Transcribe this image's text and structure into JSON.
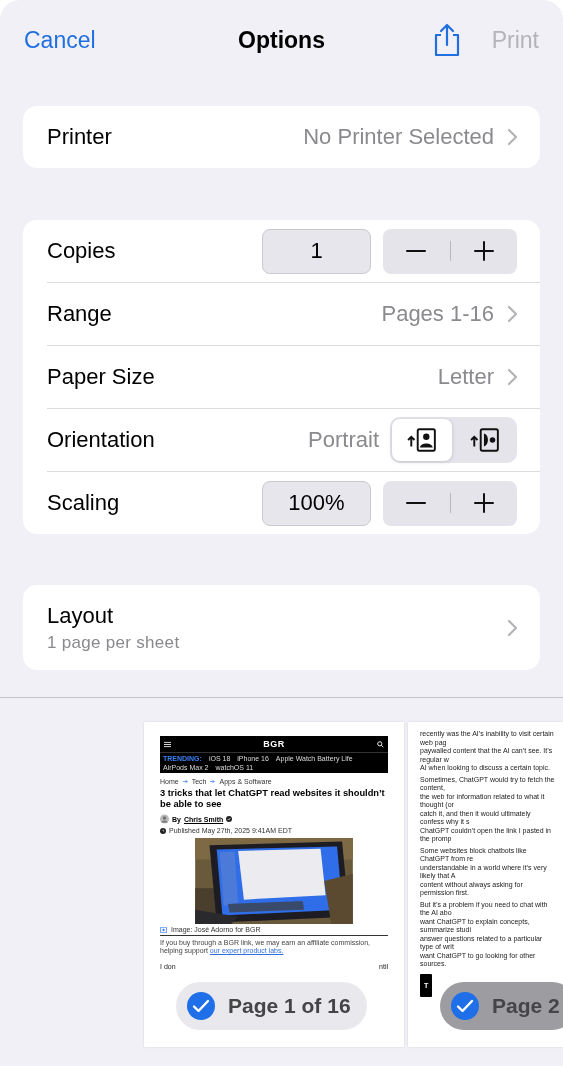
{
  "nav": {
    "cancel": "Cancel",
    "title": "Options",
    "print": {
      "label": "Print",
      "disabled": true
    }
  },
  "printer": {
    "label": "Printer",
    "value": "No Printer Selected"
  },
  "options": [
    {
      "kind": "stepper",
      "label": "Copies",
      "value": "1"
    },
    {
      "kind": "link",
      "label": "Range",
      "value": "Pages 1-16"
    },
    {
      "kind": "link",
      "label": "Paper Size",
      "value": "Letter"
    },
    {
      "kind": "orientation",
      "label": "Orientation",
      "value": "Portrait",
      "choices": [
        {
          "kind": "portrait",
          "selected": true
        },
        {
          "kind": "landscape",
          "selected": false
        }
      ]
    },
    {
      "kind": "stepper",
      "label": "Scaling",
      "value": "100%"
    }
  ],
  "layout": {
    "label": "Layout",
    "detail": "1 page per sheet"
  },
  "previews": [
    {
      "kind": "article",
      "badge": "Page 1 of 16",
      "checked": true,
      "current": true,
      "logo": "BGR",
      "trending_label": "TRENDING:",
      "trending": [
        "iOS 18",
        "iPhone 16",
        "Apple Watch Battery Life",
        "AirPods Max 2",
        "watchOS 11"
      ],
      "breadcrumb": [
        "Home",
        "Tech",
        "Apps & Software"
      ],
      "headline": "3 tricks that let ChatGPT read websites it shouldn’t be able to see",
      "byline": "By",
      "author": "Chris Smith",
      "published": "Published May 27th, 2025 9:41AM EDT",
      "photo": {
        "kind": "picture"
      },
      "caption": "Image: José Adorno for BGR",
      "disclosure": "If you buy through a BGR link, we may earn an affiliate commission, helping support",
      "disclosure_link": "our expert product labs.",
      "fragments": [
        "I don",
        "ntil"
      ]
    },
    {
      "kind": "text",
      "badge": "Page 2",
      "checked": true,
      "current": false,
      "paragraphs": [
        [
          "recently was the AI’s inability to visit certain web pag",
          "paywalled content that the AI can’t see. It’s regular w",
          "AI when looking to discuss a certain topic."
        ],
        [
          "Sometimes, ChatGPT would try to fetch the content,",
          "the web for information related to what it thought (or",
          "catch it, and then it would ultimately confess why it s",
          "ChatGPT couldn’t open the link I pasted in the promp"
        ],
        [
          "Some websites block chatbots like ChatGPT from re",
          "understandable in a world where it’s very likely that A",
          "content without always asking for permission first."
        ],
        [
          "But it’s a problem if you need to chat with the AI abo",
          "want ChatGPT to explain concepts, summarize studi",
          "answer questions related to a particular type of writ",
          "want ChatGPT to go looking for other sources."
        ]
      ],
      "button_fragment": "T"
    }
  ]
}
